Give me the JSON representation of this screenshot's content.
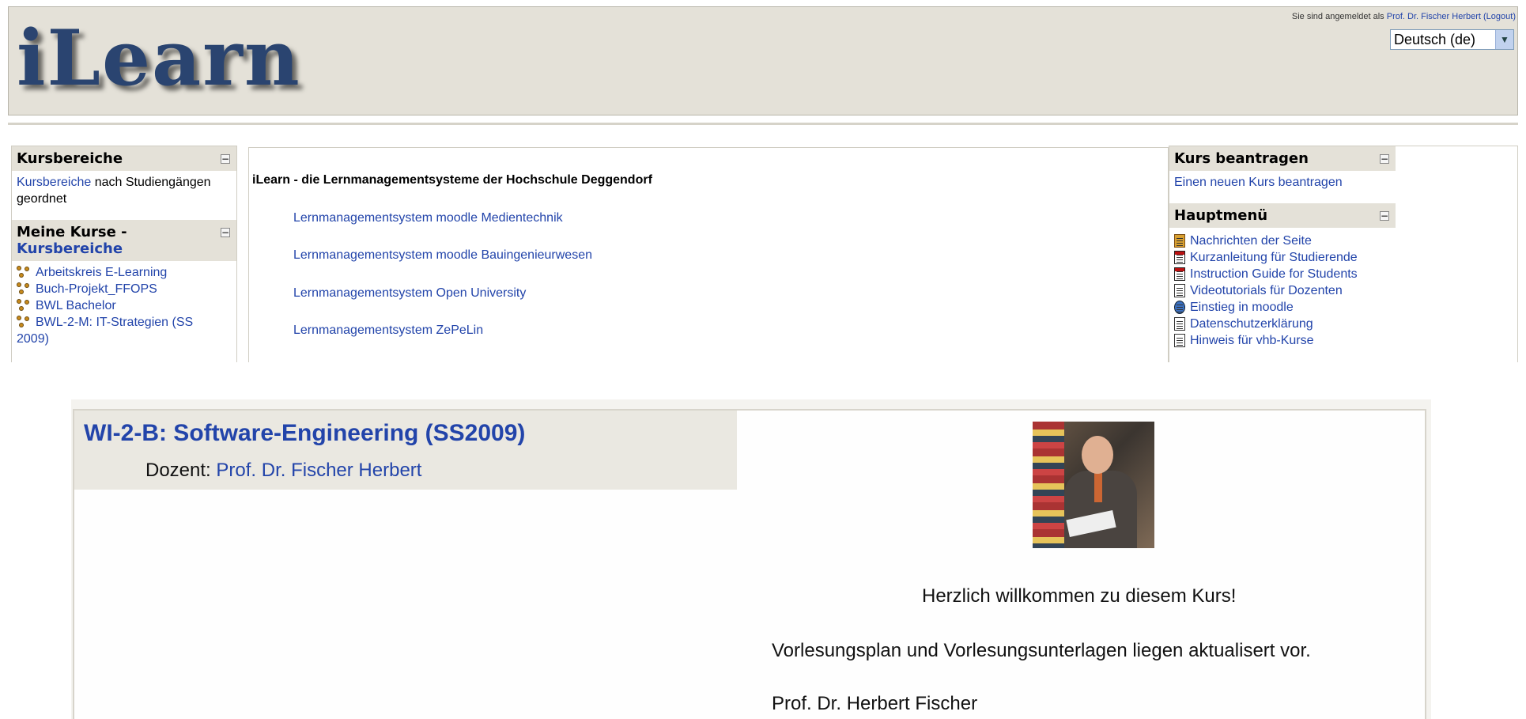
{
  "header": {
    "logo_text": "iLearn",
    "login_prefix": "Sie sind angemeldet als",
    "login_user": "Prof. Dr. Fischer Herbert",
    "logout": "(Logout)",
    "language": "Deutsch (de)"
  },
  "left": {
    "kursbereiche": {
      "title": "Kursbereiche",
      "link": "Kursbereiche",
      "rest": "nach Studiengängen geordnet"
    },
    "meine_kurse": {
      "title_prefix": "Meine Kurse -",
      "title_link": "Kursbereiche",
      "courses": [
        "Arbeitskreis E-Learning",
        "Buch-Projekt_FFOPS",
        "BWL Bachelor",
        "BWL-2-M: IT-Strategien (SS",
        "2009)"
      ]
    }
  },
  "center": {
    "title": "iLearn - die Lernmanagementsysteme der Hochschule Deggendorf",
    "links": [
      "Lernmanagementsystem moodle Medientechnik",
      "Lernmanagementsystem moodle Bauingenieurwesen",
      "Lernmanagementsystem Open University",
      "Lernmanagementsystem ZePeLin"
    ]
  },
  "right": {
    "kurs_beantragen": {
      "title": "Kurs beantragen",
      "link": "Einen neuen Kurs beantragen"
    },
    "hauptmenu": {
      "title": "Hauptmenü",
      "items": [
        {
          "label": "Nachrichten der Seite",
          "icon": "news-icon"
        },
        {
          "label": "Kurzanleitung für Studierende",
          "icon": "pdf-icon"
        },
        {
          "label": "Instruction Guide for Students",
          "icon": "pdf-icon"
        },
        {
          "label": "Videotutorials für Dozenten",
          "icon": "document-icon"
        },
        {
          "label": "Einstieg in moodle",
          "icon": "globe-icon"
        },
        {
          "label": "Datenschutzerklärung",
          "icon": "document-icon"
        },
        {
          "label": "Hinweis für vhb-Kurse",
          "icon": "document-icon"
        }
      ]
    }
  },
  "course": {
    "title": "WI-2-B: Software-Engineering (SS2009)",
    "lecturer_label": "Dozent:",
    "lecturer_name": "Prof. Dr. Fischer Herbert",
    "welcome": "Herzlich willkommen zu diesem Kurs!",
    "notice": "Vorlesungsplan und Vorlesungsunterlagen liegen aktualisert vor.",
    "signature": "Prof. Dr. Herbert Fischer"
  }
}
